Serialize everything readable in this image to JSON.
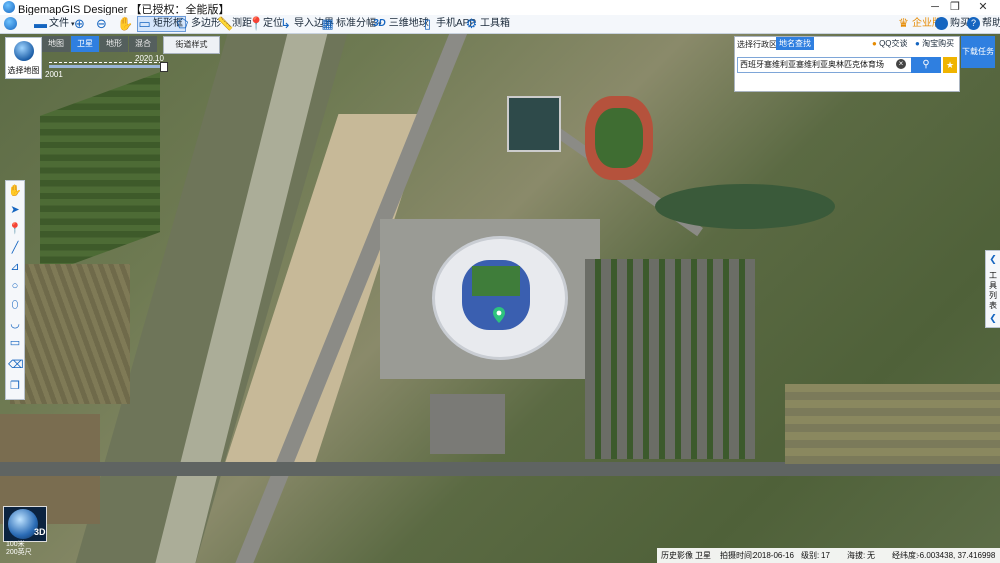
{
  "app": {
    "title": "BigemapGIS Designer 【已授权：全能版】",
    "window_controls": [
      "─",
      "❐",
      "✕"
    ]
  },
  "toolbar": {
    "file": "文件",
    "rect_tool": "矩形框",
    "polygon_tool": "多边形",
    "measure": "测距",
    "locate": "定位",
    "import_boundary": "导入边界",
    "standard_tiles": "标准分幅",
    "earth3d": "三维地球",
    "earth3d_badge": "3D",
    "mobile_app": "手机APP",
    "toolbox": "工具箱",
    "enterprise": "企业版",
    "feedback": "购买",
    "help": "帮助"
  },
  "map_controls": {
    "select_map": "选择地图",
    "tabs": [
      "地图",
      "卫星",
      "地形",
      "混合"
    ],
    "active_tab": "卫星",
    "road_style": "街道样式",
    "timeline_start": "2001",
    "timeline_end": "2020.10"
  },
  "search": {
    "admin_region": "选择行政区域",
    "place_search": "地名查找",
    "qq_chat": "QQ交谈",
    "taobao": "淘宝购买",
    "query": "西班牙塞维利亚塞维利亚奥林匹克体育场",
    "download": "下载任务"
  },
  "right_panel": {
    "label": "工具列表"
  },
  "minimap": {
    "label": "3D",
    "scale_top": "100米",
    "scale_bottom": "200英尺"
  },
  "status": {
    "history": "历史影像",
    "layer": "卫星",
    "capture_label": "拍摄时间:",
    "capture_date": "2018-06-16",
    "level_label": "级别:",
    "level": "17",
    "altitude_label": "海拔:",
    "altitude": "无",
    "coords_label": "经纬度:",
    "coords": "-6.003438, 37.416998"
  },
  "colors": {
    "accent": "#2f7fe0",
    "toolbar_bg": "#f4f7fb",
    "star": "#f0b400"
  }
}
